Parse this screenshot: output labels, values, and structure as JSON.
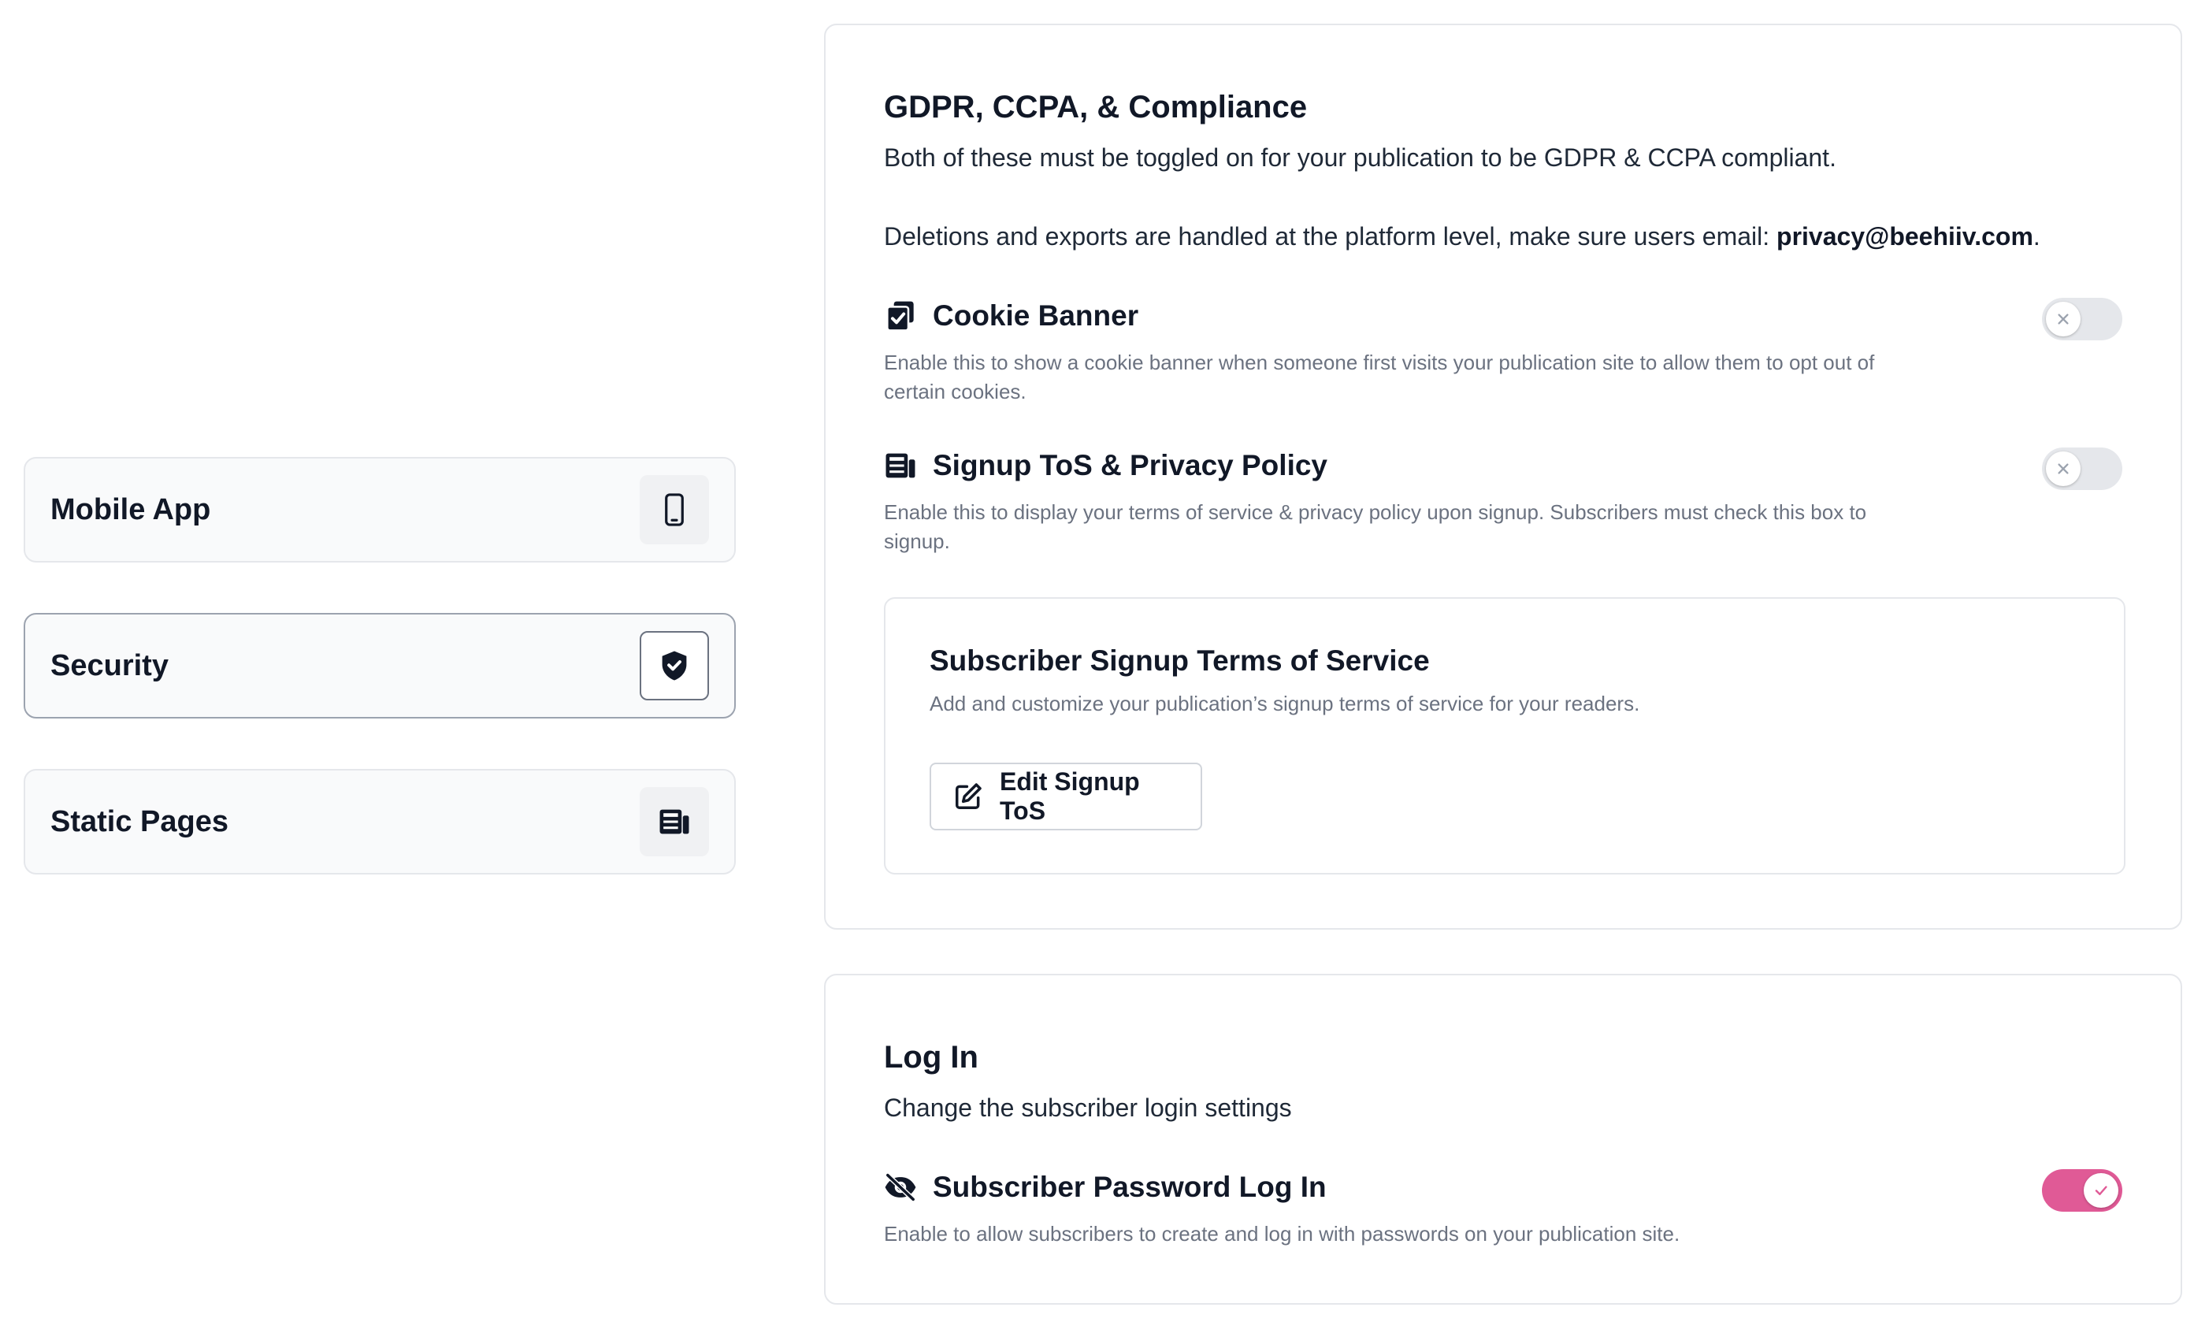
{
  "sidebar": {
    "items": [
      {
        "label": "Mobile App",
        "icon": "mobile-phone-icon"
      },
      {
        "label": "Security",
        "icon": "shield-check-icon",
        "active": true
      },
      {
        "label": "Static Pages",
        "icon": "newspaper-icon"
      }
    ]
  },
  "compliance": {
    "title": "GDPR, CCPA, & Compliance",
    "desc1": "Both of these must be toggled on for your publication to be GDPR & CCPA compliant.",
    "desc2_prefix": "Deletions and exports are handled at the platform level, make sure users email: ",
    "desc2_email": "privacy@beehiiv.com",
    "desc2_suffix": ".",
    "cookie": {
      "title": "Cookie Banner",
      "desc": "Enable this to show a cookie banner when someone first visits your publication site to allow them to opt out of certain cookies.",
      "enabled": false
    },
    "tos": {
      "title": "Signup ToS & Privacy Policy",
      "desc": "Enable this to display your terms of service & privacy policy upon signup. Subscribers must check this box to signup.",
      "enabled": false
    },
    "terms_card": {
      "title": "Subscriber Signup Terms of Service",
      "desc": "Add and customize your publication’s signup terms of service for your readers.",
      "button_label": "Edit Signup ToS"
    }
  },
  "login": {
    "title": "Log In",
    "desc": "Change the subscriber login settings",
    "password": {
      "title": "Subscriber Password Log In",
      "desc": "Enable to allow subscribers to create and log in with passwords on your publication site.",
      "enabled": true
    }
  },
  "colors": {
    "accent": "#e05a96",
    "toggle_off": "#e5e7eb"
  }
}
